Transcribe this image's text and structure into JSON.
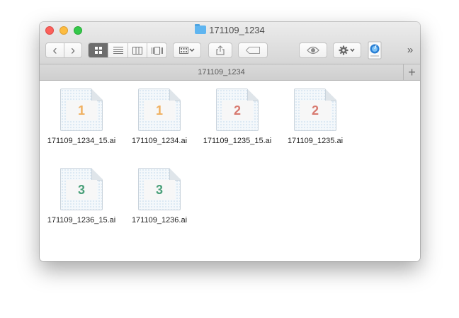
{
  "window": {
    "title": "171109_1234",
    "path_tab": "171109_1234",
    "new_tab_symbol": "+",
    "overflow_symbol": "»"
  },
  "toolbar": {
    "back_icon": "‹",
    "forward_icon": "›",
    "view_modes": [
      "icon-view",
      "list-view",
      "column-view",
      "coverflow-view"
    ],
    "active_view": "icon-view",
    "arrange_icon": "arrange-icon",
    "share_icon": "share-icon",
    "tag_icon": "tag-icon",
    "quicklook_icon": "eye-icon",
    "action_icon": "gear-icon",
    "app_icon": "preview-app-icon"
  },
  "files": [
    {
      "name": "171109_1234_15.ai",
      "label": "1",
      "color": "#f0b060"
    },
    {
      "name": "171109_1234.ai",
      "label": "1",
      "color": "#f0b060"
    },
    {
      "name": "171109_1235_15.ai",
      "label": "2",
      "color": "#d87a70"
    },
    {
      "name": "171109_1235.ai",
      "label": "2",
      "color": "#d87a70"
    },
    {
      "name": "171109_1236_15.ai",
      "label": "3",
      "color": "#4aa07a"
    },
    {
      "name": "171109_1236.ai",
      "label": "3",
      "color": "#4aa07a"
    }
  ]
}
